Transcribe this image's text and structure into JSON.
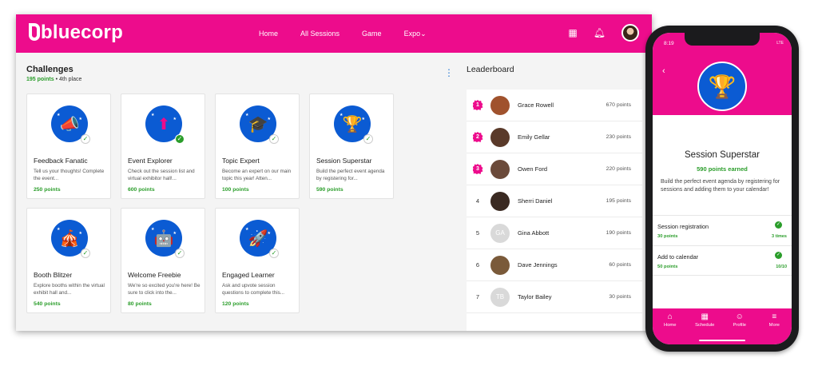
{
  "app": {
    "brand": "bluecorp",
    "nav": [
      "Home",
      "All Sessions",
      "Game",
      "Expo"
    ],
    "nav_expo_caret": "⌄",
    "icons": [
      "calendar-icon",
      "bell-icon",
      "avatar"
    ]
  },
  "challenges": {
    "title": "Challenges",
    "points": "195 points",
    "separator": "•",
    "place": "4th place",
    "more_icon": "⋮",
    "cards": [
      {
        "title": "Feedback Fanatic",
        "desc": "Tell us your thoughts! Complete the event...",
        "points": "250 points",
        "icon": "megaphone-icon",
        "glyph": "📣",
        "completed": false
      },
      {
        "title": "Event Explorer",
        "desc": "Check out the session list and virtual exhibitor hall!...",
        "points": "600 points",
        "icon": "arrow-up-icon",
        "glyph": "⬆",
        "completed": true
      },
      {
        "title": "Topic Expert",
        "desc": "Become an expert on our main topic this year! Atten...",
        "points": "100 points",
        "icon": "graduation-cap-icon",
        "glyph": "🎓",
        "completed": false
      },
      {
        "title": "Session Superstar",
        "desc": "Build the perfect event agenda by registering for...",
        "points": "590 points",
        "icon": "trophy-icon",
        "glyph": "🏆",
        "completed": false
      },
      {
        "title": "Booth Blitzer",
        "desc": "Explore booths within the virtual exhibit hall and...",
        "points": "540 points",
        "icon": "booth-icon",
        "glyph": "🎪",
        "completed": false
      },
      {
        "title": "Welcome Freebie",
        "desc": "We're so excited you're here! Be sure to click into the...",
        "points": "80 points",
        "icon": "robot-icon",
        "glyph": "🤖",
        "completed": false
      },
      {
        "title": "Engaged Learner",
        "desc": "Ask and upvote session questions to complete this...",
        "points": "120 points",
        "icon": "rocket-icon",
        "glyph": "🚀",
        "completed": false
      }
    ]
  },
  "leaderboard": {
    "title": "Leaderboard",
    "rows": [
      {
        "rank": "1",
        "name": "Grace Rowell",
        "points": "670 points",
        "initials": "",
        "avatar_color": "#a0522d",
        "top": true
      },
      {
        "rank": "2",
        "name": "Emily Gellar",
        "points": "230 points",
        "initials": "",
        "avatar_color": "#5a3a2a",
        "top": true
      },
      {
        "rank": "3",
        "name": "Owen Ford",
        "points": "220 points",
        "initials": "",
        "avatar_color": "#6b4a3a",
        "top": true
      },
      {
        "rank": "4",
        "name": "Sherri Daniel",
        "points": "195 points",
        "initials": "",
        "avatar_color": "#3a2a22",
        "top": false
      },
      {
        "rank": "5",
        "name": "Gina Abbott",
        "points": "190 points",
        "initials": "GA",
        "avatar_color": "#d9d9d9",
        "top": false
      },
      {
        "rank": "6",
        "name": "Dave Jennings",
        "points": "60 points",
        "initials": "",
        "avatar_color": "#7a5a3a",
        "top": false
      },
      {
        "rank": "7",
        "name": "Taylor Bailey",
        "points": "30 points",
        "initials": "TB",
        "avatar_color": "#d9d9d9",
        "top": false
      }
    ]
  },
  "phone": {
    "time": "8:19",
    "status": "LTE",
    "back_icon": "‹",
    "badge_glyph": "🏆",
    "title": "Session Superstar",
    "earned": "590 points earned",
    "description": "Build the perfect event agenda by registering for sessions and adding them to your calendar!",
    "items": [
      {
        "name": "Session registration",
        "points": "30 points",
        "count": "3 times"
      },
      {
        "name": "Add to calendar",
        "points": "50 points",
        "count": "10/10"
      }
    ],
    "tabs": [
      {
        "label": "Home",
        "glyph": "⌂",
        "icon": "home-icon"
      },
      {
        "label": "Schedule",
        "glyph": "▦",
        "icon": "schedule-icon"
      },
      {
        "label": "Profile",
        "glyph": "☺",
        "icon": "profile-icon"
      },
      {
        "label": "More",
        "glyph": "≡",
        "icon": "more-icon"
      }
    ]
  },
  "colors": {
    "brand_pink": "#ed0c8c",
    "badge_blue": "#0b5bd3",
    "points_green": "#2a9d2a"
  }
}
